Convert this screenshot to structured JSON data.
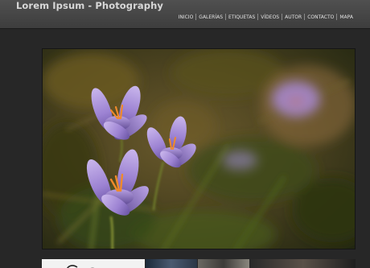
{
  "header": {
    "site_title": "Lorem Ipsum - Photography"
  },
  "nav": {
    "items": [
      {
        "label": "INICIO"
      },
      {
        "label": "GALERÍAS"
      },
      {
        "label": "ETIQUETAS"
      },
      {
        "label": "VÍDEOS"
      },
      {
        "label": "AUTOR"
      },
      {
        "label": "CONTACTO"
      },
      {
        "label": "MAPA"
      }
    ]
  },
  "colors": {
    "header_bg": "#454545",
    "page_bg": "#272727",
    "title_text": "#d8d8d8",
    "nav_text": "#e2e2e2"
  }
}
